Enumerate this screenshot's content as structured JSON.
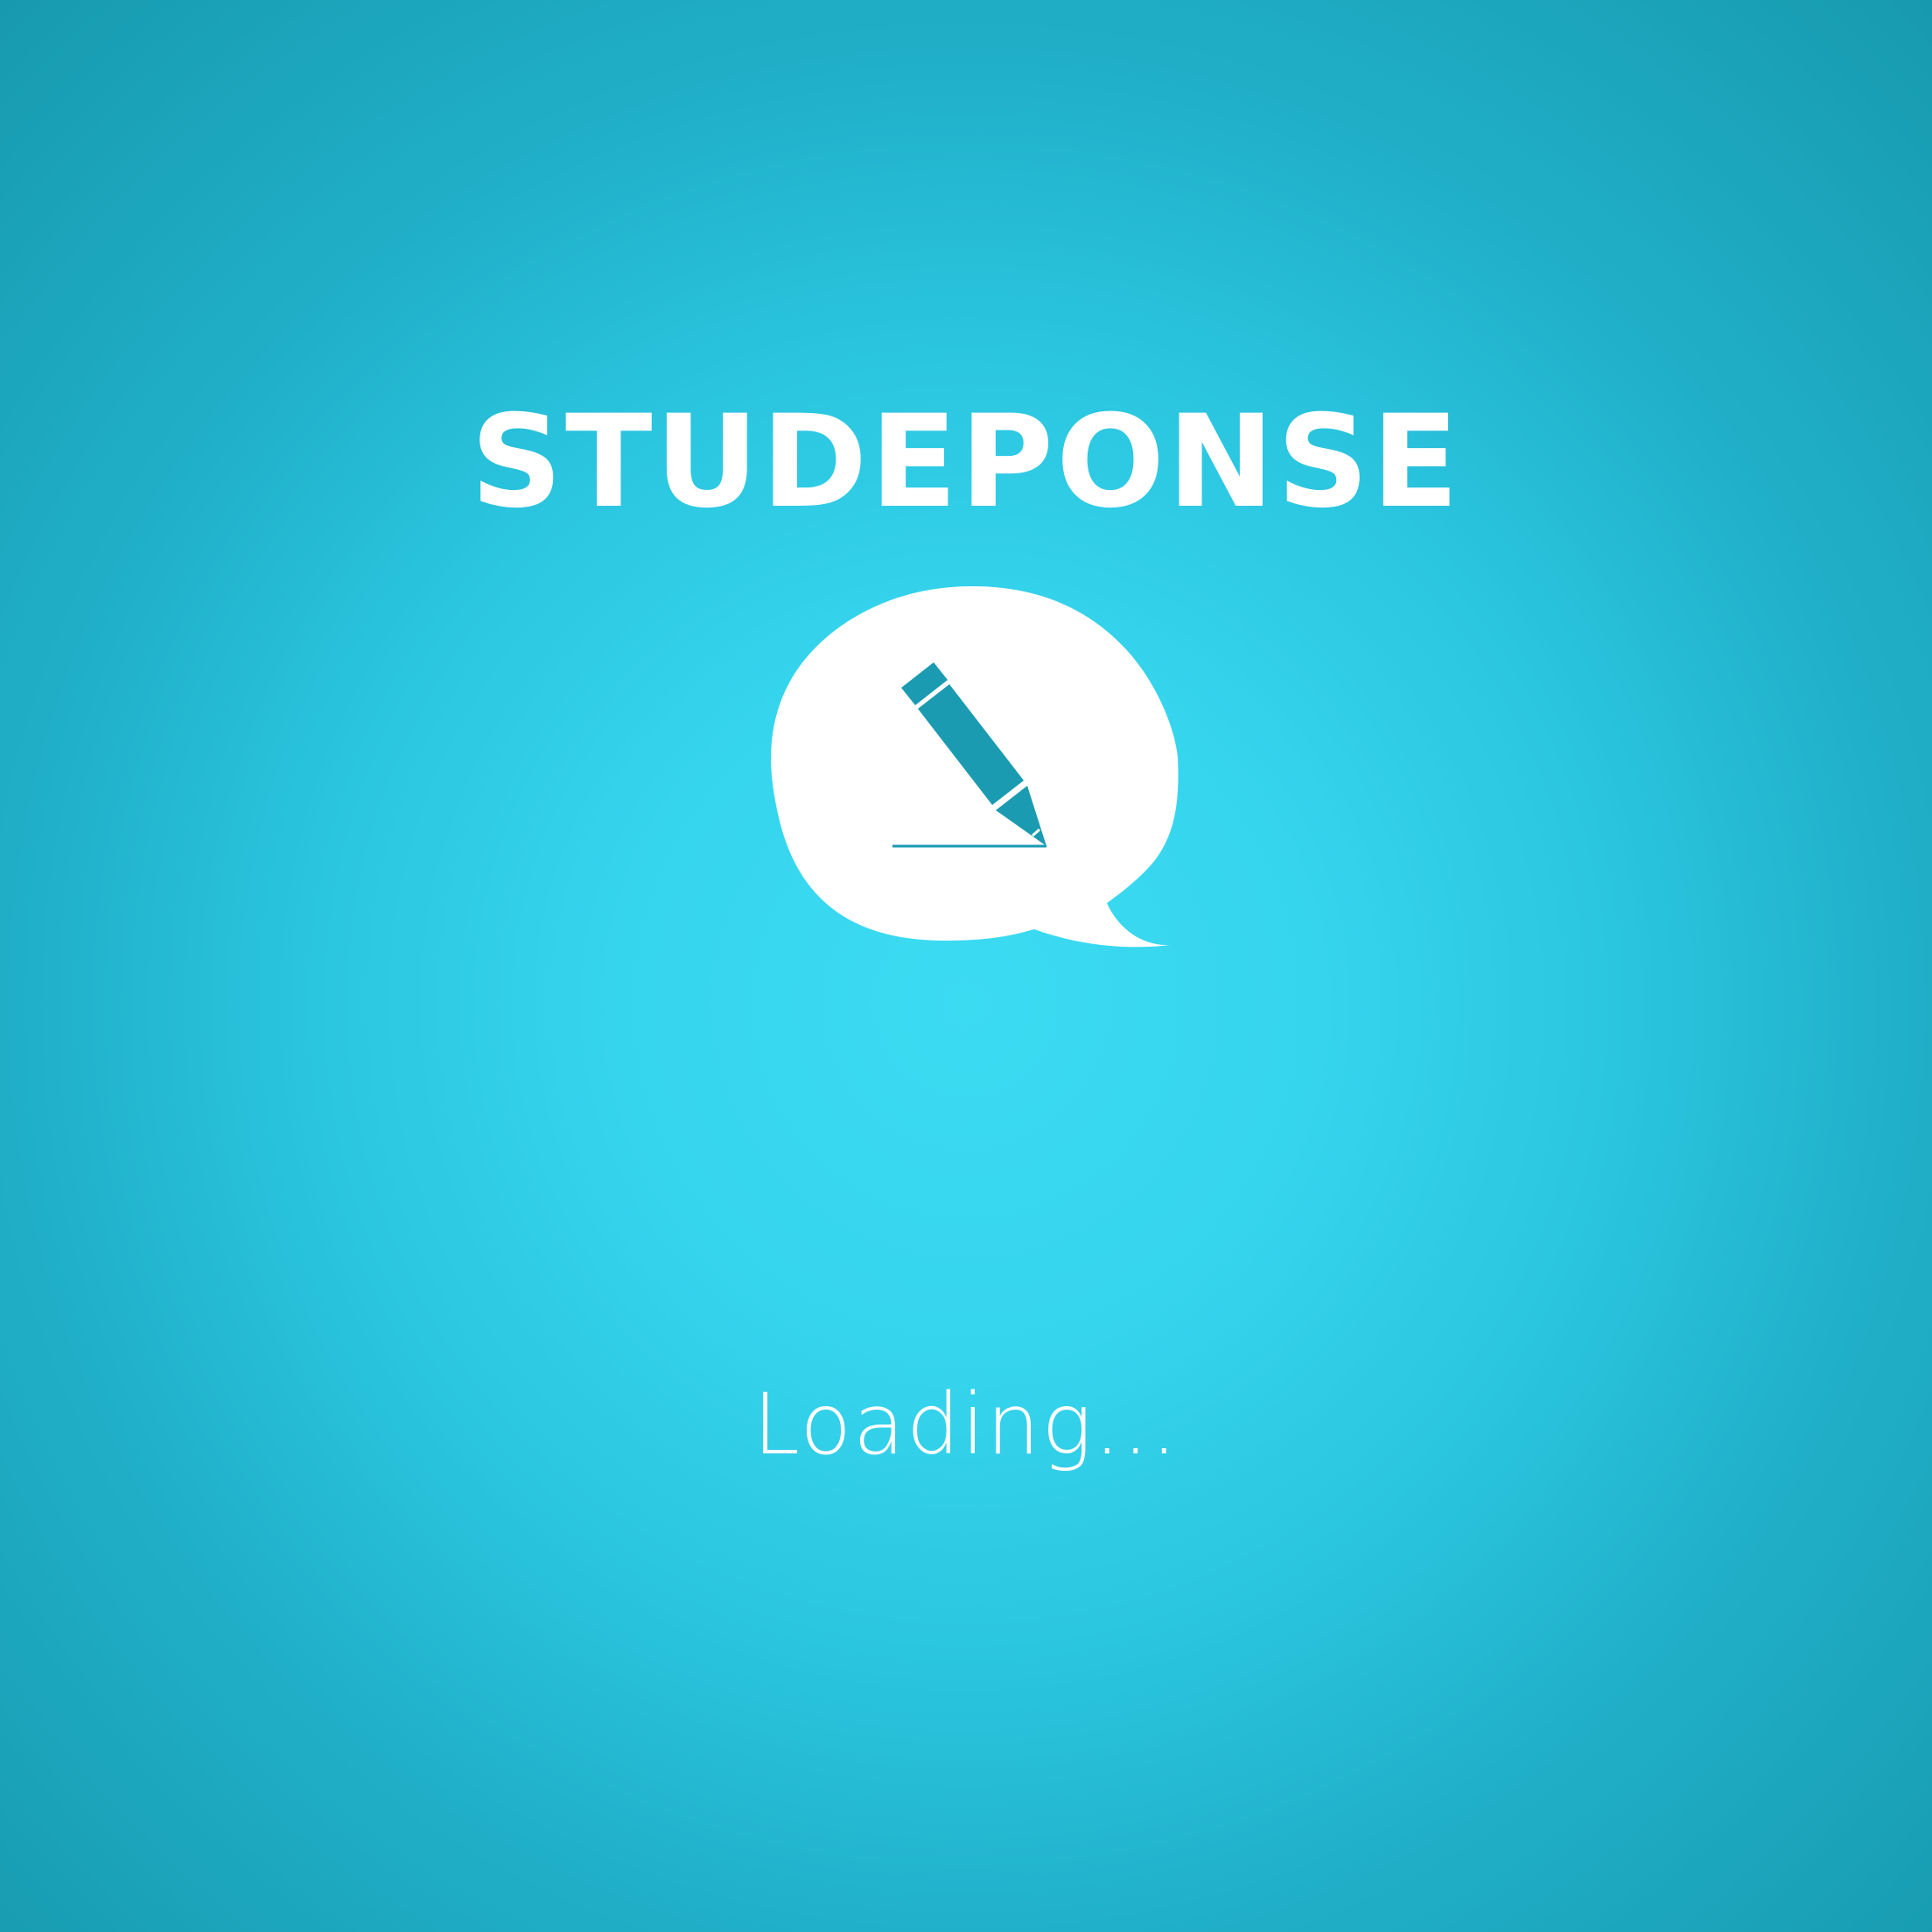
{
  "app": {
    "title": "STUDEPONSE",
    "logo_icon": "speech-bubble-pencil-icon",
    "loading_text": "Loading..."
  },
  "colors": {
    "background_center": "#3bdbf2",
    "background_edge": "#179aaf",
    "logo_fill": "#ffffff",
    "pencil_fill": "#1a9bb2",
    "text": "#ffffff"
  }
}
